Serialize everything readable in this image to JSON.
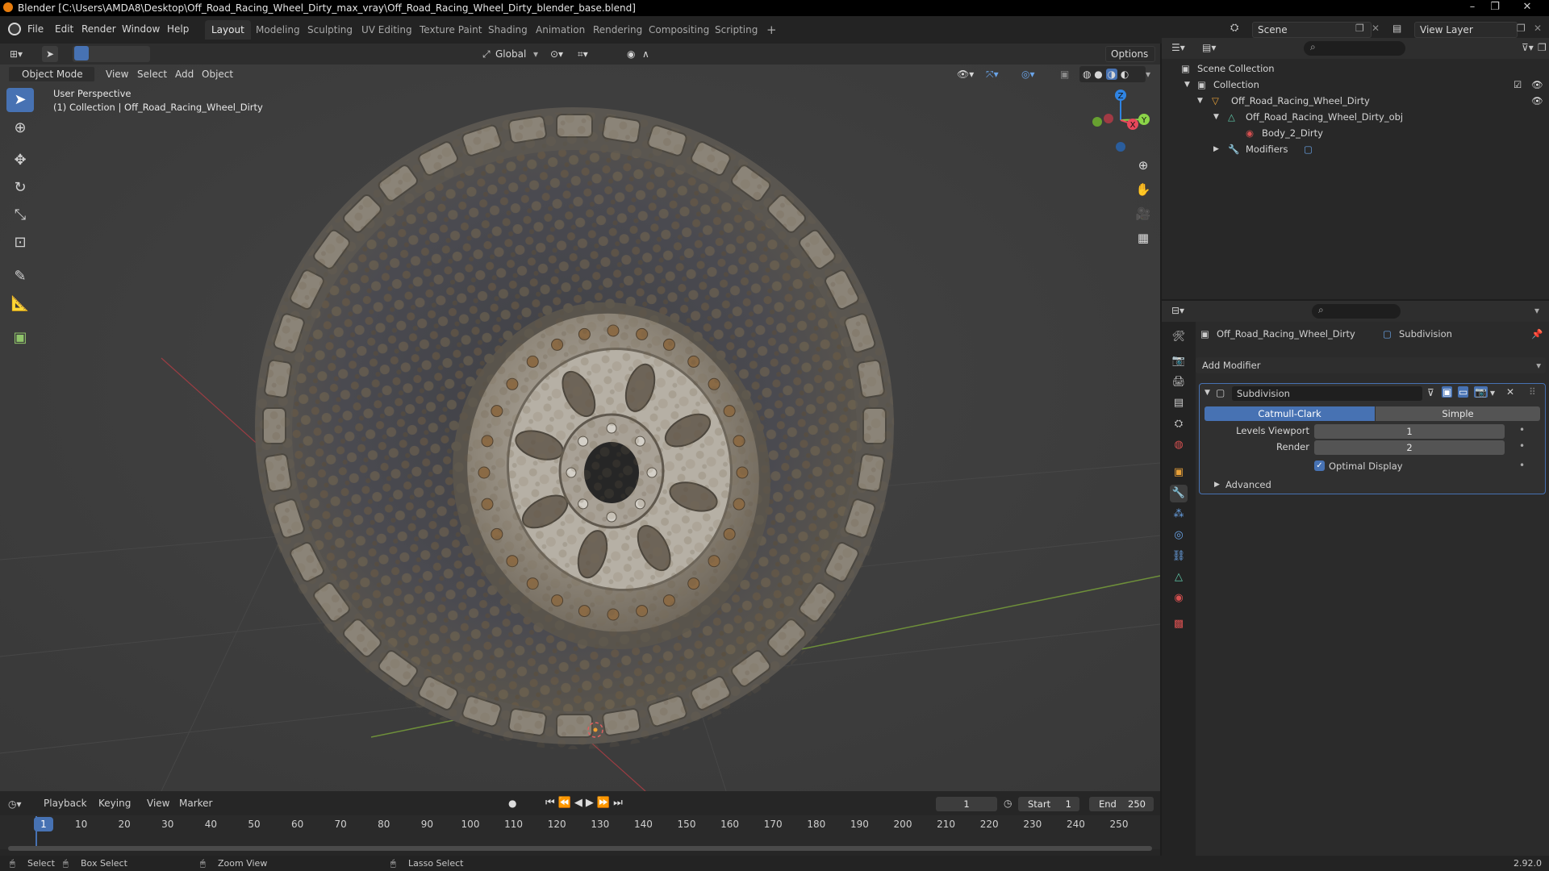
{
  "window": {
    "title": "Blender [C:\\Users\\AMDA8\\Desktop\\Off_Road_Racing_Wheel_Dirty_max_vray\\Off_Road_Racing_Wheel_Dirty_blender_base.blend]",
    "minimize": "–",
    "maximize": "❐",
    "close": "✕"
  },
  "menu": {
    "items": [
      "File",
      "Edit",
      "Render",
      "Window",
      "Help"
    ],
    "workspaces": [
      "Layout",
      "Modeling",
      "Sculpting",
      "UV Editing",
      "Texture Paint",
      "Shading",
      "Animation",
      "Rendering",
      "Compositing",
      "Scripting"
    ],
    "active_workspace": "Layout",
    "add_tab": "+",
    "scene_label": "Scene",
    "view_layer_label": "View Layer"
  },
  "viewport": {
    "header": {
      "transform_orientation": "Global",
      "options_label": "Options"
    },
    "header2": {
      "mode": "Object Mode",
      "menus": [
        "View",
        "Select",
        "Add",
        "Object"
      ]
    },
    "overlay_text": {
      "perspective": "User Perspective",
      "collection": "(1) Collection | Off_Road_Racing_Wheel_Dirty"
    },
    "gizmo": {
      "z": "Z",
      "y": "Y",
      "x": "X"
    }
  },
  "timeline": {
    "menus": [
      "Playback",
      "Keying",
      "View",
      "Marker"
    ],
    "current_frame": "1",
    "start_label": "Start",
    "start_value": "1",
    "end_label": "End",
    "end_value": "250",
    "ticks": [
      "1",
      "10",
      "20",
      "30",
      "40",
      "50",
      "60",
      "70",
      "80",
      "90",
      "100",
      "110",
      "120",
      "130",
      "140",
      "150",
      "160",
      "170",
      "180",
      "190",
      "200",
      "210",
      "220",
      "230",
      "240",
      "250"
    ]
  },
  "statusbar": {
    "select": "Select",
    "box_select": "Box Select",
    "zoom_view": "Zoom View",
    "lasso_select": "Lasso Select",
    "version": "2.92.0"
  },
  "outliner": {
    "rows": [
      {
        "label": "Scene Collection"
      },
      {
        "label": "Collection"
      },
      {
        "label": "Off_Road_Racing_Wheel_Dirty"
      },
      {
        "label": "Off_Road_Racing_Wheel_Dirty_obj"
      },
      {
        "label": "Body_2_Dirty"
      },
      {
        "label": "Modifiers"
      }
    ]
  },
  "properties": {
    "breadcrumb_object": "Off_Road_Racing_Wheel_Dirty",
    "breadcrumb_modifier": "Subdivision",
    "add_modifier": "Add Modifier",
    "modifier": {
      "name": "Subdivision",
      "type_catmull": "Catmull-Clark",
      "type_simple": "Simple",
      "levels_viewport_label": "Levels Viewport",
      "levels_viewport_value": "1",
      "render_label": "Render",
      "render_value": "2",
      "optimal_display_label": "Optimal Display",
      "optimal_display_checked": true,
      "advanced_label": "Advanced"
    }
  },
  "colors": {
    "accent": "#4772b3",
    "axis_x": "#e8485b",
    "axis_y": "#8bd448",
    "axis_z": "#2f84e3"
  }
}
